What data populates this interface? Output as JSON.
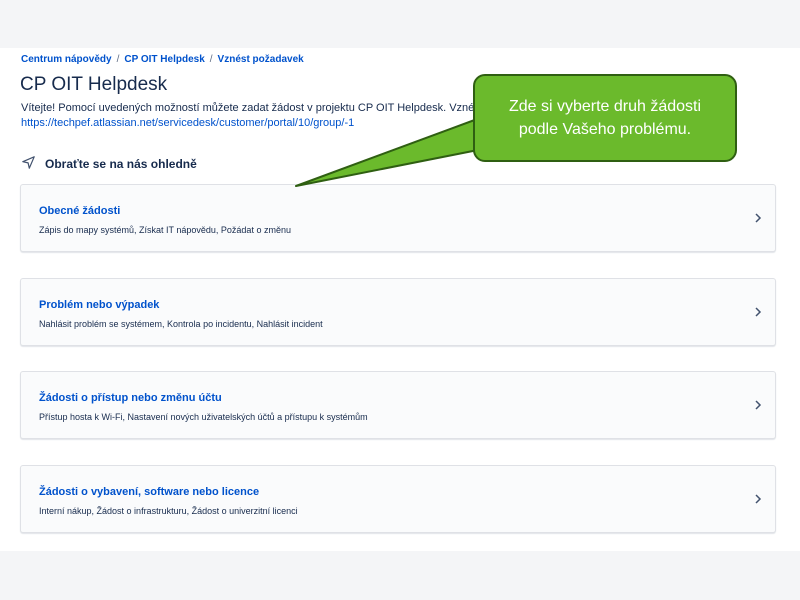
{
  "breadcrumb": {
    "items": [
      "Centrum nápovědy",
      "CP OIT Helpdesk",
      "Vznést požadavek"
    ],
    "separator": "/"
  },
  "page": {
    "title": "CP OIT Helpdesk",
    "description": "Vítejte! Pomocí uvedených možností můžete zadat žádost v projektu CP OIT Helpdesk. Vznést pož",
    "link": "https://techpef.atlassian.net/servicedesk/customer/portal/10/group/-1"
  },
  "contact": {
    "label": "Obraťte se na nás ohledně",
    "icon": "send-icon"
  },
  "cards": [
    {
      "title": "Obecné žádosti",
      "subtitle": "Zápis do mapy systémů, Získat IT nápovědu, Požádat o změnu"
    },
    {
      "title": "Problém nebo výpadek",
      "subtitle": "Nahlásit problém se systémem, Kontrola po incidentu, Nahlásit incident"
    },
    {
      "title": "Žádosti o přístup nebo změnu účtu",
      "subtitle": "Přístup hosta k Wi-Fi, Nastavení nových uživatelských účtů a přístupu k systémům"
    },
    {
      "title": "Žádosti o vybavení, software nebo licence",
      "subtitle": "Interní nákup, Žádost o infrastrukturu, Žádost o univerzitní licenci"
    }
  ],
  "callout": {
    "line1": "Zde si vyberte druh žádosti",
    "line2": "podle Vašeho problému."
  },
  "colors": {
    "link": "#0052cc",
    "callout_fill": "#6bba2c",
    "callout_border": "#2f5f12",
    "text": "#172b4d"
  }
}
